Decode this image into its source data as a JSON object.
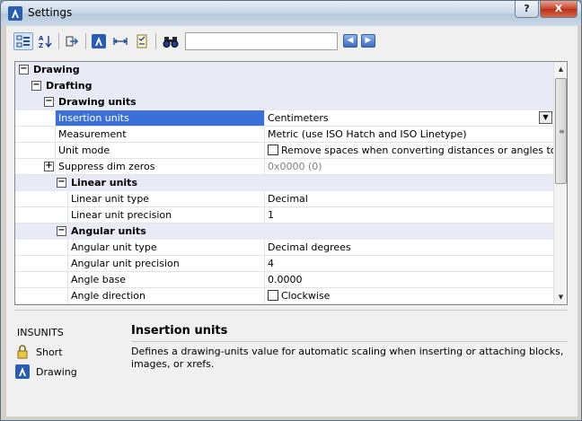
{
  "window": {
    "title": "Settings",
    "help_label": "?",
    "close_label": "X"
  },
  "toolbar": {
    "buttons": [
      {
        "name": "categorized-view-icon",
        "glyph": "⊟"
      },
      {
        "name": "alphabetical-sort-icon",
        "glyph": "A↓"
      },
      {
        "name": "export-icon",
        "glyph": "↦"
      },
      {
        "name": "drawing-settings-icon",
        "glyph": "▲"
      },
      {
        "name": "dimension-icon",
        "glyph": "↔"
      },
      {
        "name": "checklist-icon",
        "glyph": "☑"
      },
      {
        "name": "binoculars-icon",
        "glyph": "⚯"
      }
    ],
    "search": {
      "value": "",
      "placeholder": ""
    },
    "prev_label": "◀",
    "next_label": "▶"
  },
  "grid": {
    "rows": [
      {
        "kind": "cat",
        "level": 0,
        "label": "Drawing",
        "expander": "−"
      },
      {
        "kind": "cat",
        "level": 1,
        "label": "Drafting",
        "expander": "−"
      },
      {
        "kind": "cat",
        "level": 2,
        "label": "Drawing units",
        "expander": "−"
      },
      {
        "kind": "prop",
        "level": 3,
        "label": "Insertion units",
        "value": "Centimeters",
        "selected": true,
        "dropdown": true
      },
      {
        "kind": "prop",
        "level": 3,
        "label": "Measurement",
        "value": "Metric (use ISO Hatch and ISO Linetype)"
      },
      {
        "kind": "prop",
        "level": 3,
        "label": "Unit mode",
        "value": "Remove spaces when converting distances or angles to text",
        "checkbox": true
      },
      {
        "kind": "prop",
        "level": 3,
        "label": "Suppress dim zeros",
        "value": "0x0000 (0)",
        "disabled": true,
        "expander": "+"
      },
      {
        "kind": "cat",
        "level": 3,
        "label": "Linear units",
        "expander": "−"
      },
      {
        "kind": "prop",
        "level": 4,
        "label": "Linear unit type",
        "value": "Decimal"
      },
      {
        "kind": "prop",
        "level": 4,
        "label": "Linear unit precision",
        "value": "1"
      },
      {
        "kind": "cat",
        "level": 3,
        "label": "Angular units",
        "expander": "−"
      },
      {
        "kind": "prop",
        "level": 4,
        "label": "Angular unit type",
        "value": "Decimal degrees"
      },
      {
        "kind": "prop",
        "level": 4,
        "label": "Angular unit precision",
        "value": "4"
      },
      {
        "kind": "prop",
        "level": 4,
        "label": "Angle base",
        "value": "0.0000"
      },
      {
        "kind": "prop",
        "level": 4,
        "label": "Angle direction",
        "value": "Clockwise",
        "checkbox": true
      }
    ],
    "scroll": {
      "up": "▲",
      "down": "▼",
      "grip": "≡"
    }
  },
  "info": {
    "variable": "INSUNITS",
    "type_label": "Short",
    "scope_label": "Drawing",
    "title": "Insertion units",
    "description": "Defines a drawing-units value for automatic scaling when inserting or attaching blocks, images, or xrefs."
  },
  "colors": {
    "selection": "#3c6fd8",
    "category_bg": "#e8eaf6",
    "window_bg": "#f0f0f0"
  }
}
